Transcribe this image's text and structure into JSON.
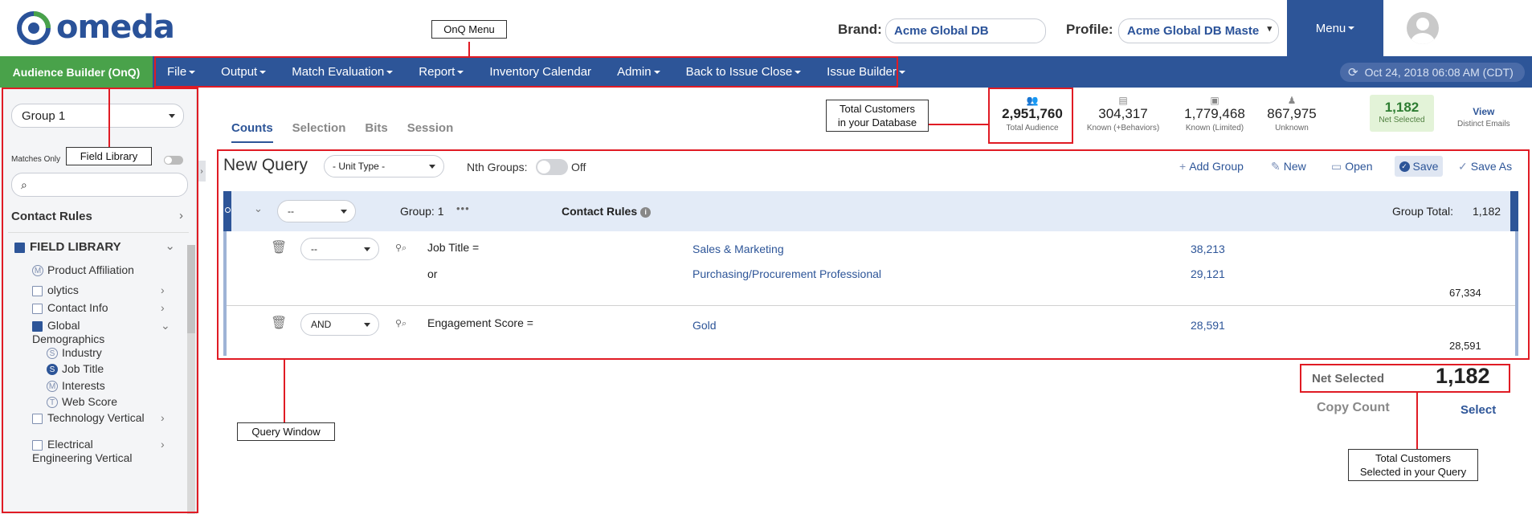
{
  "header": {
    "logo_text": "omeda",
    "brand_label": "Brand:",
    "brand_value": "Acme Global DB",
    "profile_label": "Profile:",
    "profile_value": "Acme Global DB Maste",
    "menu_label": "Menu"
  },
  "navbar": {
    "app_label": "Audience Builder (OnQ)",
    "items": [
      "File",
      "Output",
      "Match Evaluation",
      "Report",
      "Inventory Calendar",
      "Admin",
      "Back to Issue Close",
      "Issue Builder"
    ],
    "dropdown_items": [
      true,
      true,
      true,
      true,
      false,
      true,
      true,
      true
    ],
    "datetime": "Oct 24, 2018 06:08 AM (CDT)"
  },
  "sidebar": {
    "group_select": "Group 1",
    "matches_only_label": "Matches Only",
    "contact_rules": "Contact Rules",
    "field_library_heading": "FIELD LIBRARY",
    "items": [
      {
        "type": "badge",
        "badge": "M",
        "label": "Product Affiliation",
        "chevron": ""
      },
      {
        "type": "folder",
        "label": "olytics",
        "chevron": "›"
      },
      {
        "type": "folder",
        "label": "Contact Info",
        "chevron": "›"
      },
      {
        "type": "folder-open",
        "label": "Global Demographics",
        "chevron": "⌄"
      },
      {
        "type": "badge",
        "badge": "S",
        "label": "Industry",
        "chevron": ""
      },
      {
        "type": "badge-filled",
        "badge": "S",
        "label": "Job Title",
        "chevron": ""
      },
      {
        "type": "badge",
        "badge": "M",
        "label": "Interests",
        "chevron": ""
      },
      {
        "type": "badge",
        "badge": "T",
        "label": "Web Score",
        "chevron": ""
      },
      {
        "type": "folder",
        "label": "Technology Vertical",
        "chevron": "›"
      },
      {
        "type": "folder",
        "label": "Electrical Engineering Vertical",
        "chevron": "›"
      }
    ]
  },
  "tabs": [
    "Counts",
    "Selection",
    "Bits",
    "Session"
  ],
  "stats": {
    "total_audience": {
      "value": "2,951,760",
      "label": "Total Audience",
      "icon": "users-icon"
    },
    "known_behaviors": {
      "value": "304,317",
      "label": "Known (+Behaviors)",
      "icon": "id-card-icon"
    },
    "known_limited": {
      "value": "1,779,468",
      "label": "Known (Limited)",
      "icon": "badge-icon"
    },
    "unknown": {
      "value": "867,975",
      "label": "Unknown",
      "icon": "user-secret-icon"
    },
    "net_selected": {
      "value": "1,182",
      "label": "Net Selected"
    },
    "view_emails": {
      "link": "View",
      "label": "Distinct Emails"
    }
  },
  "query": {
    "title": "New Query",
    "unit_type": "- Unit Type -",
    "nth_groups_label": "Nth Groups:",
    "nth_groups_state": "Off",
    "actions": {
      "add_group": "Add Group",
      "new": "New",
      "open": "Open",
      "save": "Save",
      "save_as": "Save As"
    },
    "group": {
      "operator": "--",
      "label": "Group: 1",
      "contact_rules": "Contact Rules",
      "total_label": "Group Total:",
      "total_value": "1,182"
    },
    "rules": [
      {
        "operator": "--",
        "field": "Job Title =",
        "values": [
          {
            "label": "Sales & Marketing",
            "count": "38,213",
            "prefix": ""
          },
          {
            "label": "Purchasing/Procurement Professional",
            "count": "29,121",
            "prefix": "or"
          }
        ],
        "total": "67,334"
      },
      {
        "operator": "AND",
        "field": "Engagement Score =",
        "values": [
          {
            "label": "Gold",
            "count": "28,591",
            "prefix": ""
          }
        ],
        "total": "28,591"
      }
    ]
  },
  "net_selected_footer": {
    "label": "Net Selected",
    "value": "1,182",
    "copy_count": "Copy Count",
    "select": "Select"
  },
  "annotations": {
    "onq_menu": "OnQ Menu",
    "field_library": "Field Library",
    "total_customers_line1": "Total Customers",
    "total_customers_line2": "in your Database",
    "query_window": "Query Window",
    "selected_line1": "Total Customers",
    "selected_line2": "Selected in your Query",
    "color": "#e01b24"
  }
}
